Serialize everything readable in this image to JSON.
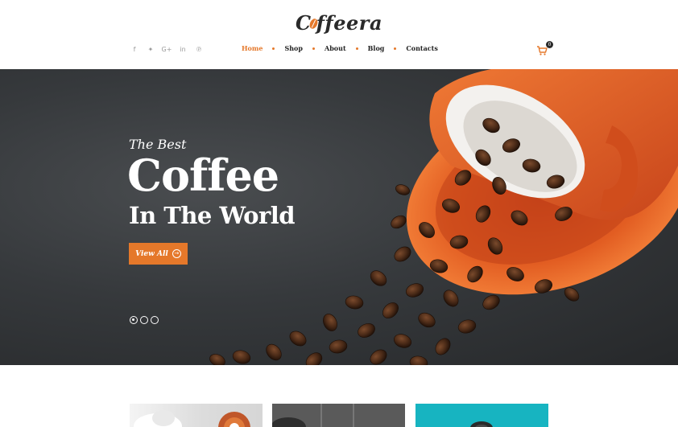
{
  "logo": {
    "part_a": "C",
    "part_b": "ffeera"
  },
  "social": [
    {
      "icon": "facebook-icon",
      "glyph": "f"
    },
    {
      "icon": "twitter-icon",
      "glyph": "✦"
    },
    {
      "icon": "google-plus-icon",
      "glyph": "G+"
    },
    {
      "icon": "linkedin-icon",
      "glyph": "in"
    },
    {
      "icon": "pinterest-icon",
      "glyph": "℗"
    }
  ],
  "nav": {
    "home": "Home",
    "shop": "Shop",
    "about": "About",
    "blog": "Blog",
    "contacts": "Contacts"
  },
  "cart": {
    "icon": "cart-icon",
    "count": "0"
  },
  "hero": {
    "subtitle": "The Best",
    "title": "Coffee",
    "title2": "In The World",
    "button_label": "View All",
    "slides": 3,
    "active_slide": 1
  },
  "colors": {
    "accent": "#e5782a",
    "dark": "#2a2a2a",
    "hero_bg": "#36393c",
    "cup": "#e0571f",
    "teal": "#17b4c1"
  }
}
